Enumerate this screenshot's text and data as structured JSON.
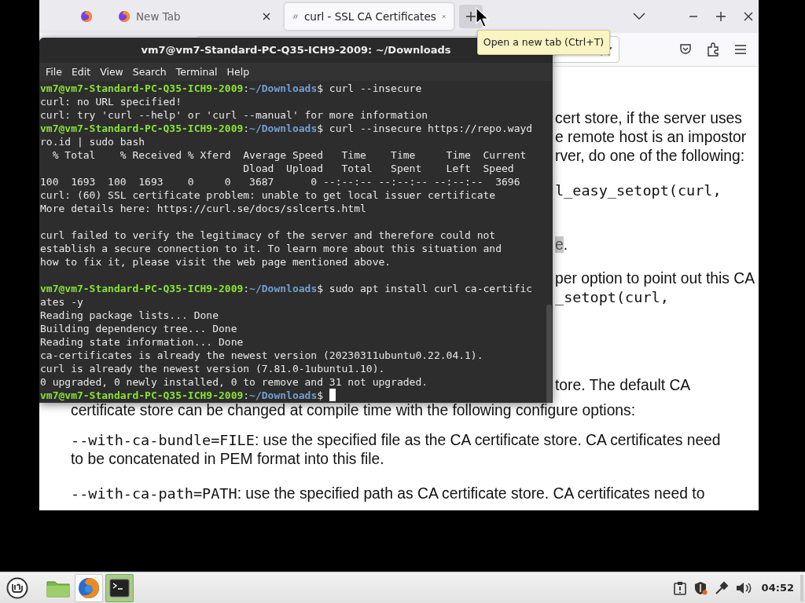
{
  "browser": {
    "tabs": [
      {
        "kind": "pinned",
        "selected": false
      },
      {
        "kind": "blank",
        "label": "New Tab",
        "selected": false
      },
      {
        "kind": "site",
        "label": "curl - SSL CA Certificates",
        "selected": true
      }
    ],
    "new_tab_hovered": true,
    "tooltip": "Open a new tab (Ctrl+T)",
    "content": [
      {
        "kind": "cut",
        "parts": [
          {
            "kind": "text",
            "text": "cert store, if the server uses"
          }
        ]
      },
      {
        "kind": "cut",
        "parts": [
          {
            "kind": "text",
            "text": "e remote host is an impostor"
          }
        ]
      },
      {
        "kind": "cut",
        "parts": [
          {
            "kind": "text",
            "text": "rver, do one of the following:"
          }
        ]
      },
      {
        "kind": "cut",
        "parts": [
          {
            "kind": "code",
            "text": "l_easy_setopt(curl,"
          }
        ]
      },
      {
        "kind": "cut",
        "parts": [
          {
            "kind": "mark",
            "text": "e"
          },
          {
            "kind": "text",
            "text": "."
          }
        ]
      },
      {
        "kind": "cut",
        "parts": [
          {
            "kind": "text",
            "text": "per option to point out this CA"
          }
        ]
      },
      {
        "kind": "cut",
        "parts": [
          {
            "kind": "code",
            "text": "_setopt(curl,"
          }
        ]
      },
      {
        "kind": "cut",
        "parts": [
          {
            "kind": "text",
            "text": "tore. The default CA"
          }
        ]
      },
      {
        "kind": "whole",
        "parts": [
          {
            "kind": "text",
            "text": "certificate store can be changed at compile time with the following configure options:"
          }
        ]
      },
      {
        "kind": "whole",
        "parts": [
          {
            "kind": "code",
            "text": "--with-ca-bundle=FILE"
          },
          {
            "kind": "text",
            "text": ": use the specified file as the CA certificate store. CA certificates need"
          }
        ]
      },
      {
        "kind": "whole",
        "parts": [
          {
            "kind": "text",
            "text": "to be concatenated in PEM format into this file."
          }
        ]
      },
      {
        "kind": "whole",
        "parts": [
          {
            "kind": "code",
            "text": "--with-ca-path=PATH"
          },
          {
            "kind": "text",
            "text": ": use the specified path as CA certificate store. CA certificates need to"
          }
        ]
      }
    ]
  },
  "terminal": {
    "title": "vm7@vm7-Standard-PC-Q35-ICH9-2009: ~/Downloads",
    "menu": [
      "File",
      "Edit",
      "View",
      "Search",
      "Terminal",
      "Help"
    ],
    "cursor_visible": true,
    "lines": [
      {
        "kind": "prompt",
        "host": "vm7@vm7-Standard-PC-Q35-ICH9-2009",
        "sep": ":",
        "path": "~/Downloads",
        "command": "$ curl --insecure"
      },
      {
        "kind": "output",
        "text": "curl: no URL specified!"
      },
      {
        "kind": "output",
        "text": "curl: try 'curl --help' or 'curl --manual' for more information"
      },
      {
        "kind": "prompt",
        "host": "vm7@vm7-Standard-PC-Q35-ICH9-2009",
        "sep": ":",
        "path": "~/Downloads",
        "command": "$ curl --insecure https://repo.wayd"
      },
      {
        "kind": "output",
        "text": "ro.id | sudo bash"
      },
      {
        "kind": "output",
        "text": "  % Total    % Received % Xferd  Average Speed   Time    Time     Time  Current"
      },
      {
        "kind": "output",
        "text": "                                 Dload  Upload   Total   Spent    Left  Speed"
      },
      {
        "kind": "output",
        "text": "100  1693  100  1693    0     0   3687      0 --:--:-- --:--:-- --:--:--  3696"
      },
      {
        "kind": "output",
        "text": "curl: (60) SSL certificate problem: unable to get local issuer certificate"
      },
      {
        "kind": "output",
        "text": "More details here: https://curl.se/docs/sslcerts.html"
      },
      {
        "kind": "blank"
      },
      {
        "kind": "output",
        "text": "curl failed to verify the legitimacy of the server and therefore could not"
      },
      {
        "kind": "output",
        "text": "establish a secure connection to it. To learn more about this situation and"
      },
      {
        "kind": "output",
        "text": "how to fix it, please visit the web page mentioned above."
      },
      {
        "kind": "blank"
      },
      {
        "kind": "prompt",
        "host": "vm7@vm7-Standard-PC-Q35-ICH9-2009",
        "sep": ":",
        "path": "~/Downloads",
        "command": "$ sudo apt install curl ca-certific"
      },
      {
        "kind": "output",
        "text": "ates -y"
      },
      {
        "kind": "output",
        "text": "Reading package lists... Done"
      },
      {
        "kind": "output",
        "text": "Building dependency tree... Done"
      },
      {
        "kind": "output",
        "text": "Reading state information... Done"
      },
      {
        "kind": "output",
        "text": "ca-certificates is already the newest version (20230311ubuntu0.22.04.1)."
      },
      {
        "kind": "output",
        "text": "curl is already the newest version (7.81.0-1ubuntu1.10)."
      },
      {
        "kind": "output",
        "text": "0 upgraded, 0 newly installed, 0 to remove and 31 not upgraded."
      },
      {
        "kind": "prompt",
        "host": "vm7@vm7-Standard-PC-Q35-ICH9-2009",
        "sep": ":",
        "path": "~/Downloads",
        "command": "$"
      }
    ]
  },
  "taskbar": {
    "apps": [
      {
        "kind": "folder",
        "running": false,
        "focused": false
      },
      {
        "kind": "firefox",
        "running": true,
        "focused": false
      },
      {
        "kind": "terminal",
        "running": true,
        "focused": true
      }
    ],
    "clock": "04:52"
  }
}
